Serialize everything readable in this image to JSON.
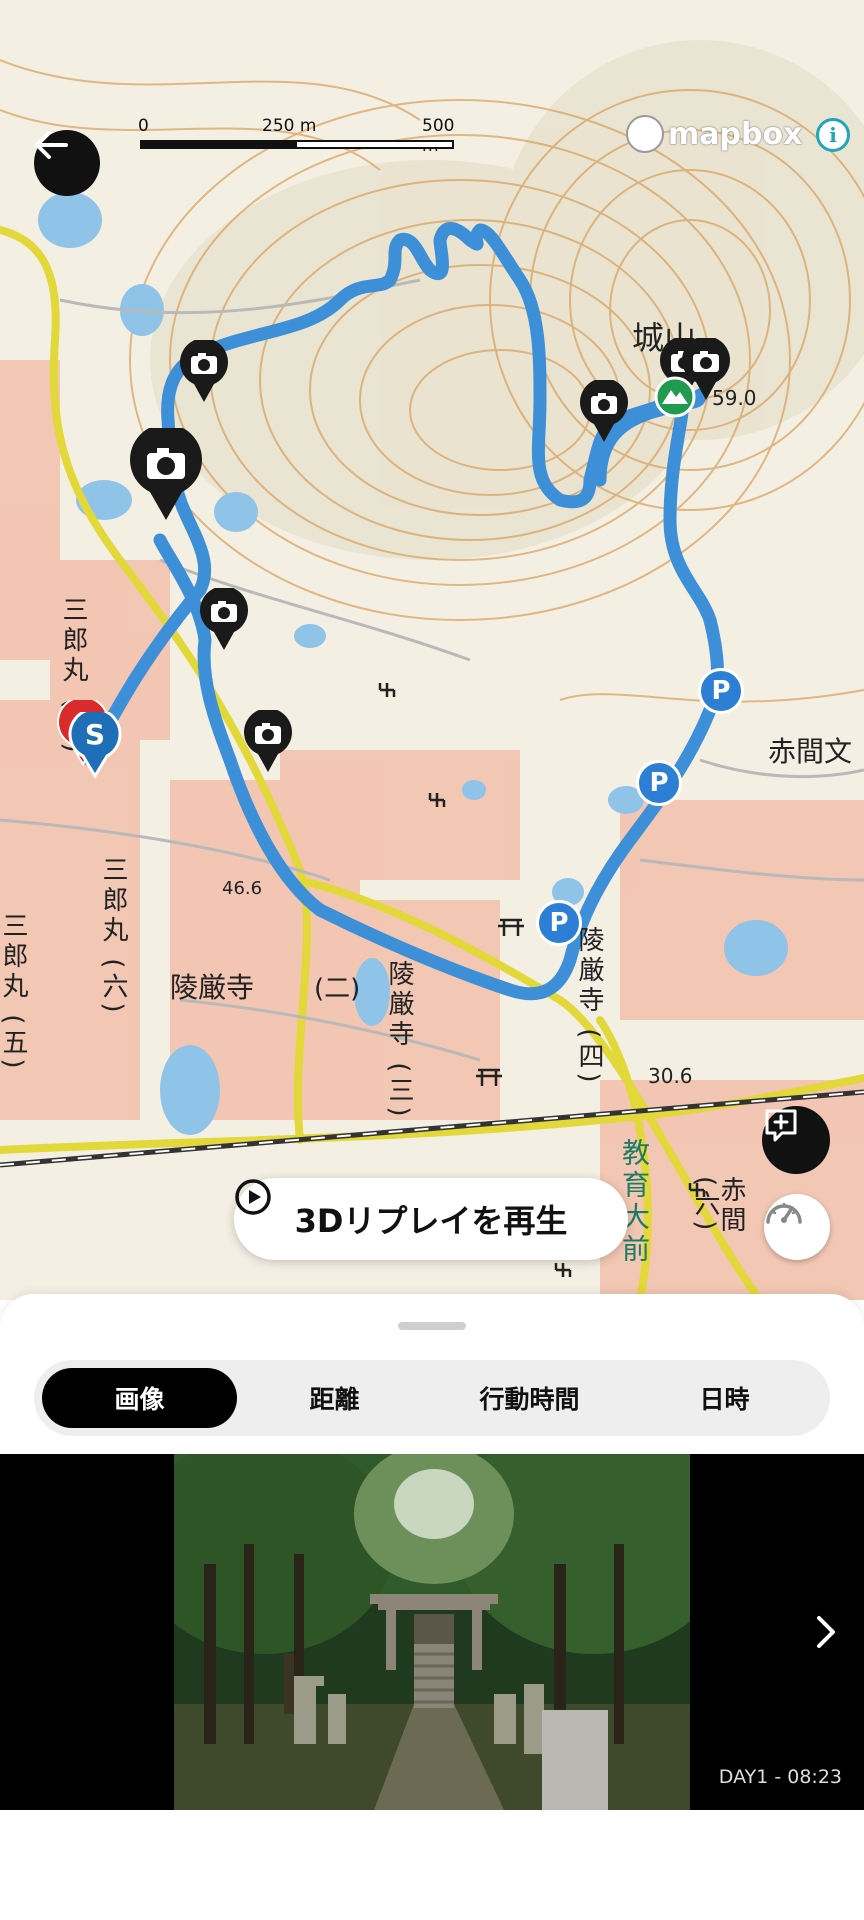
{
  "map": {
    "scale": {
      "tick_0": "0",
      "tick_250": "250 m",
      "tick_500": "500 m"
    },
    "attribution": {
      "logo_text": "mapbox",
      "info_symbol": "i"
    },
    "place_labels": {
      "shiroyama": "城山",
      "summit_elev": "59.0",
      "akama_bun": "赤間文",
      "saburomaru_4": "三郎丸 (四)",
      "saburomaru_6": "三郎丸 (六)",
      "saburomaru_5": "三郎丸 (五)",
      "ryogonji": "陵厳寺",
      "ryogonji_2": "(二)",
      "ryogonji_3": "陵厳寺 (三)",
      "ryogonji_4": "陵厳寺 (四)",
      "elev_46": "46.6",
      "elev_30": "30.6",
      "kyoiku_daimae": "教育大前",
      "akama_6": "赤間 (六)"
    },
    "markers": {
      "start_label": "S",
      "parking_label": "P"
    }
  },
  "controls": {
    "back_icon": "arrow-left-icon",
    "comment_icon": "comment-add-icon",
    "speed_icon": "speedometer-icon",
    "replay_label": "3Dリプレイを再生"
  },
  "sheet": {
    "tabs": [
      {
        "label": "画像",
        "active": true
      },
      {
        "label": "距離",
        "active": false
      },
      {
        "label": "行動時間",
        "active": false
      },
      {
        "label": "日時",
        "active": false
      }
    ],
    "photo": {
      "caption": "DAY1 - 08:23",
      "next_icon": "chevron-right-icon"
    }
  },
  "colors": {
    "route": "#3d8fd8",
    "marker_dark": "#1a1a1a",
    "parking": "#2d7fd6",
    "start_red": "#d92b2b",
    "summit_green": "#1f9a4f"
  }
}
